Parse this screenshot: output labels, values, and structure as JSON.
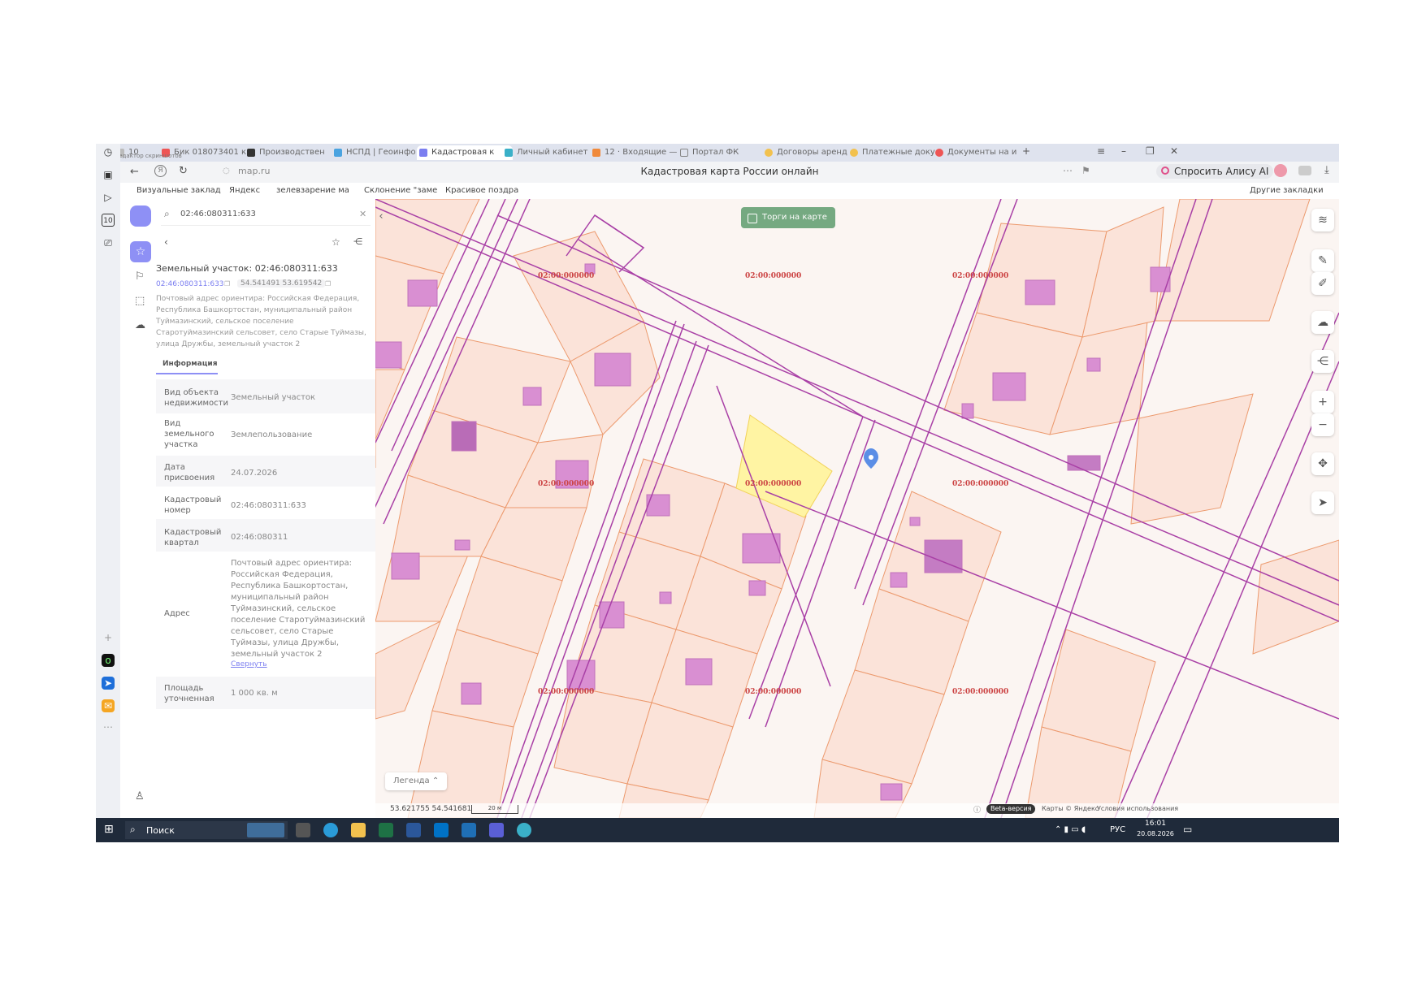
{
  "browser": {
    "tabs": [
      {
        "label": "10"
      },
      {
        "label": "Бик 018073401 к"
      },
      {
        "label": "Производствен"
      },
      {
        "label": "НСПД | Геоинфо"
      },
      {
        "label": "Кадастровая к"
      },
      {
        "label": "Личный кабинет"
      },
      {
        "label": "12 · Входящие —"
      },
      {
        "label": "Портал ФК"
      },
      {
        "label": "Договоры аренд"
      },
      {
        "label": "Платежные доку"
      },
      {
        "label": "Документы на и"
      }
    ],
    "subtitle": "Редактор скриншотов",
    "url": "map.ru",
    "page_title": "Кадастровая карта России онлайн",
    "alisa_label": "Спросить Алису AI",
    "bookmarks": [
      "Визуальные заклад",
      "Яндекс",
      "зелевзарение ма",
      "Склонение \"заме",
      "Красивое поздра"
    ],
    "other_bookmarks": "Другие закладки"
  },
  "panel": {
    "search_value": "02:46:080311:633",
    "object_title": "Земельный участок: 02:46:080311:633",
    "cad_link": "02:46:080311:633",
    "coords": "54.541491 53.619542",
    "address_short": "Почтовый адрес ориентира: Российская Федерация, Республика Башкортостан, муниципальный район Туймазинский, сельское поселение Старотуймазинский сельсовет, село Старые Туймазы, улица Дружбы, земельный участок 2",
    "tab_info": "Информация",
    "rows": [
      {
        "key": "Вид объекта недвижимости",
        "value": "Земельный участок"
      },
      {
        "key": "Вид земельного участка",
        "value": "Землепользование"
      },
      {
        "key": "Дата присвоения",
        "value": "24.07.2026"
      },
      {
        "key": "Кадастровый номер",
        "value": "02:46:080311:633"
      },
      {
        "key": "Кадастровый квартал",
        "value": "02:46:080311"
      },
      {
        "key": "Адрес",
        "value": "Почтовый адрес ориентира: Российская Федерация, Республика Башкортостан, муниципальный район Туймазинский, сельское поселение Старотуймазинский сельсовет, село Старые Туймазы, улица Дружбы, земельный участок 2"
      },
      {
        "key": "Площадь уточненная",
        "value": "1 000 кв. м"
      }
    ],
    "collapse_link": "Свернуть"
  },
  "map": {
    "torgi_button": "Торги на карте",
    "legend_button": "Легенда",
    "cad_label": "02:00:000000",
    "cursor_coords": "53.621755  54.541681",
    "scale": "20 м",
    "beta_badge": "Beta-версия",
    "copyright": "Карты © Яндекс",
    "terms": "Условия использования"
  },
  "taskbar": {
    "search_label": "Поиск",
    "lang": "РУС",
    "time": "16:01",
    "date": "20.08.2026"
  },
  "colors": {
    "parcel_fill": "#fbe3d9",
    "parcel_stroke": "#ec9a6e",
    "building": "#d98fd2",
    "road_line": "#a940a6",
    "selected": "#fff4a3",
    "accent": "#7b7ef0"
  }
}
